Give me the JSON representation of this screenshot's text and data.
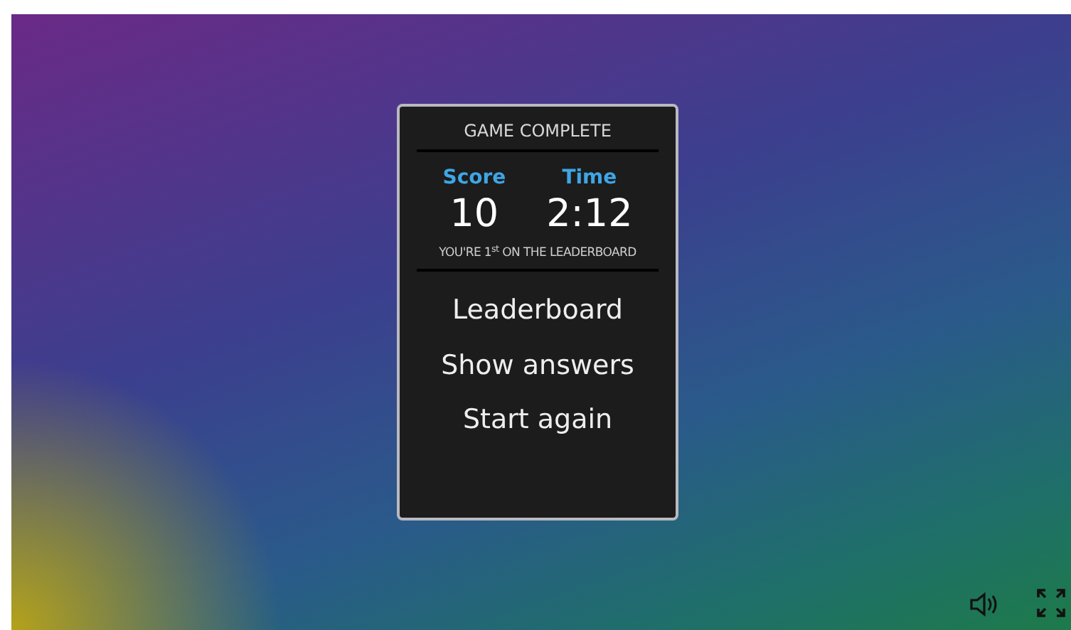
{
  "dialog": {
    "title": "GAME COMPLETE",
    "stats": [
      {
        "label": "Score",
        "value": "10"
      },
      {
        "label": "Time",
        "value": "2:12"
      }
    ],
    "rank_message": "YOU'RE 1$^{st}$ ON THE LEADERBOARD",
    "actions": [
      "Leaderboard",
      "Show answers",
      "Start again"
    ]
  }
}
